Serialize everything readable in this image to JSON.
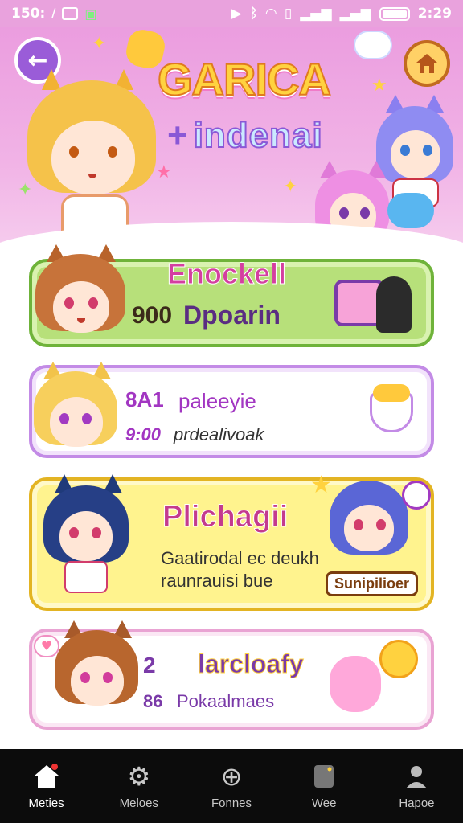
{
  "status_bar": {
    "left_text": "150:",
    "time": "2:29"
  },
  "header": {
    "title_main": "GARICA",
    "title_sub": "indenai",
    "title_plus": "+"
  },
  "cards": [
    {
      "title": "Enockell",
      "number": "900",
      "label": "Dpoarin"
    },
    {
      "line1_num": "8A1",
      "line1_label": "paleeyie",
      "line2_num": "9:00",
      "line2_label": "prdealivoak"
    },
    {
      "title": "Plichagii",
      "line1": "Gaatirodal ec deukh",
      "line2": "raunrauisi bue",
      "badge": "Sunipilioer"
    },
    {
      "line1_num": "2",
      "line1_label": "larcloafy",
      "line2_num": "86",
      "line2_label": "Pokaalmaes"
    }
  ],
  "nav": [
    {
      "label": "Meties",
      "icon": "home-icon",
      "active": true
    },
    {
      "label": "Meloes",
      "icon": "gear-icon",
      "active": false
    },
    {
      "label": "Fonnes",
      "icon": "plus-circle-icon",
      "active": false
    },
    {
      "label": "Wee",
      "icon": "device-icon",
      "active": false
    },
    {
      "label": "Hapoe",
      "icon": "user-icon",
      "active": false
    }
  ],
  "colors": {
    "header_pink": "#eb9ddf",
    "card_green": "#b7e07a",
    "card_yellow": "#fff38e",
    "accent_purple": "#9a5cd8",
    "nav_bg": "#0c0c0c"
  }
}
